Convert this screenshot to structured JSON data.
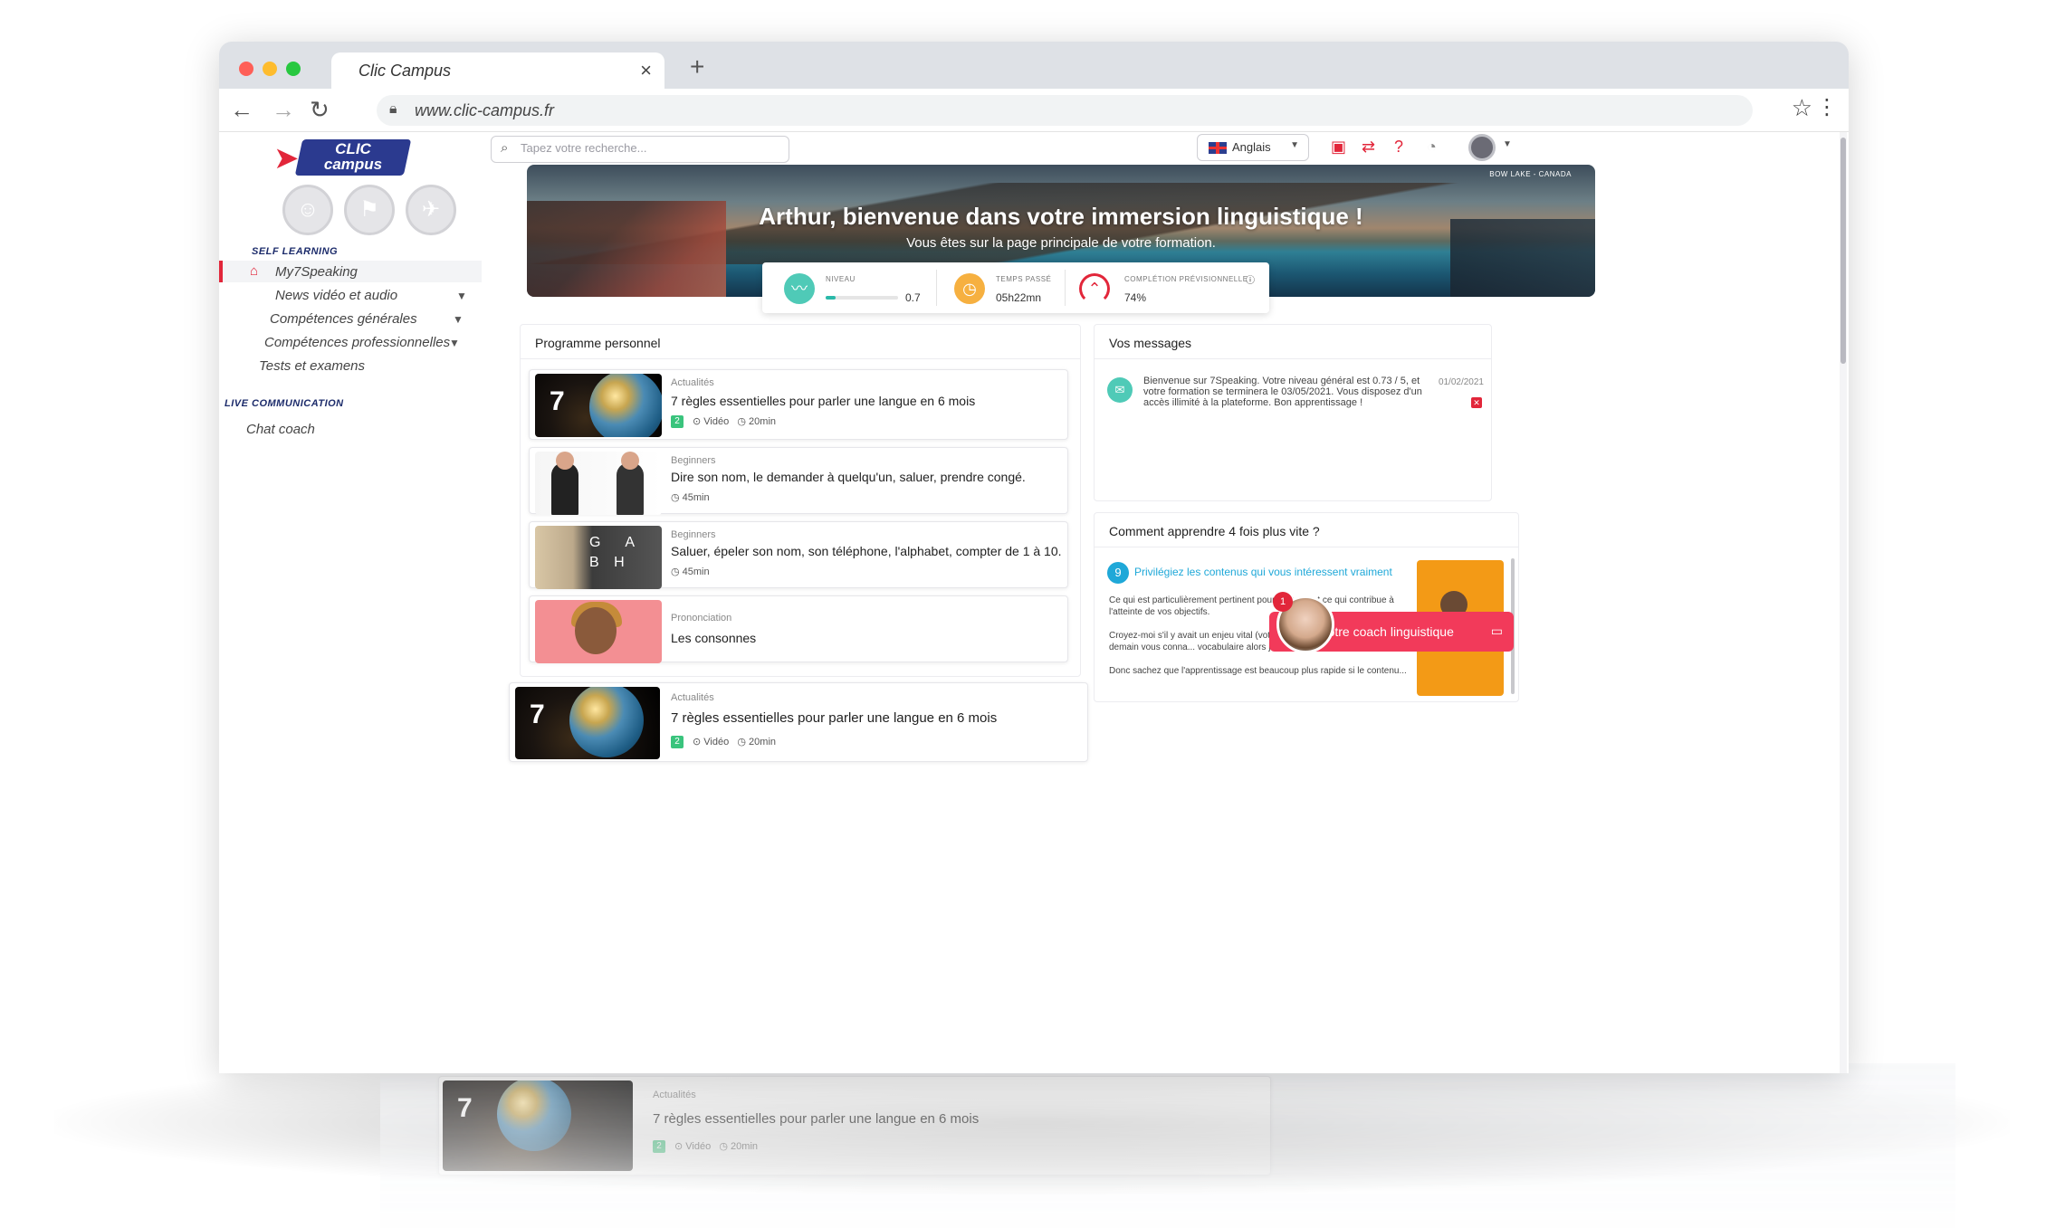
{
  "browser": {
    "tab_title": "Clic Campus",
    "tab_close": "×",
    "new_tab": "+",
    "url": "www.clic-campus.fr"
  },
  "logo": {
    "line1": "CLIC",
    "line2": "campus"
  },
  "sidebar": {
    "section_self": "SELF LEARNING",
    "items": [
      {
        "label": "My7Speaking"
      },
      {
        "label": "News vidéo et audio"
      },
      {
        "label": "Compétences générales"
      },
      {
        "label": "Compétences professionnelles"
      },
      {
        "label": "Tests et examens"
      }
    ],
    "section_live": "LIVE COMMUNICATION",
    "live_items": [
      {
        "label": "Chat coach"
      }
    ]
  },
  "topbar": {
    "search_placeholder": "Tapez votre recherche...",
    "language": "Anglais"
  },
  "hero": {
    "location": "BOW LAKE - CANADA",
    "title": "Arthur, bienvenue dans votre immersion linguistique !",
    "subtitle": "Vous êtes sur la page principale de votre formation."
  },
  "stats": {
    "level_label": "NIVEAU",
    "level_value": "0.7",
    "level_fraction": 0.14,
    "time_label": "TEMPS PASSÉ",
    "time_value": "05h22mn",
    "completion_label": "COMPLÉTION PRÉVISIONNELLE",
    "completion_value": "74%"
  },
  "program": {
    "title": "Programme personnel",
    "cards": [
      {
        "category": "Actualités",
        "title": "7 règles essentielles pour parler une langue en 6 mois",
        "level": "2",
        "type": "Vidéo",
        "duration": "20min"
      },
      {
        "category": "Beginners",
        "title": "Dire son nom, le demander à quelqu'un, saluer, prendre congé.",
        "duration": "45min"
      },
      {
        "category": "Beginners",
        "title": "Saluer, épeler son nom, son téléphone, l'alphabet, compter de 1 à 10.",
        "duration": "45min"
      },
      {
        "category": "Prononciation",
        "title": "Les consonnes"
      }
    ],
    "floating_card": {
      "category": "Actualités",
      "title": "7 règles essentielles pour parler une langue en 6 mois",
      "level": "2",
      "type": "Vidéo",
      "duration": "20min"
    }
  },
  "messages": {
    "title": "Vos messages",
    "text": "Bienvenue sur 7Speaking. Votre niveau général est 0.73 / 5, et votre formation se terminera le 03/05/2021. Vous disposez d'un accès illimité à la plateforme. Bon apprentissage !",
    "date": "01/02/2021"
  },
  "tips": {
    "title": "Comment apprendre 4 fois plus vite ?",
    "number": "9",
    "headline": "Privilégiez les contenus qui vous intéressent vraiment",
    "body1": "Ce qui est particulièrement pertinent pour vous, c'est ce qui contribue à l'atteinte de vos objectifs.",
    "body2": "Croyez-moi s'il y avait un enjeu vital (votre s... d'un rêve) à ce que d'ici demain vous conna... vocabulaire alors je vous le promets vous y arr...",
    "body3": "Donc sachez que l'apprentissage est beaucoup plus rapide si le contenu..."
  },
  "coach": {
    "label": "Votre coach linguistique",
    "badge": "1"
  },
  "reflection": {
    "category": "Actualités",
    "title": "7 règles essentielles pour parler une langue en 6 mois",
    "level": "2",
    "type": "Vidéo",
    "duration": "20min"
  }
}
